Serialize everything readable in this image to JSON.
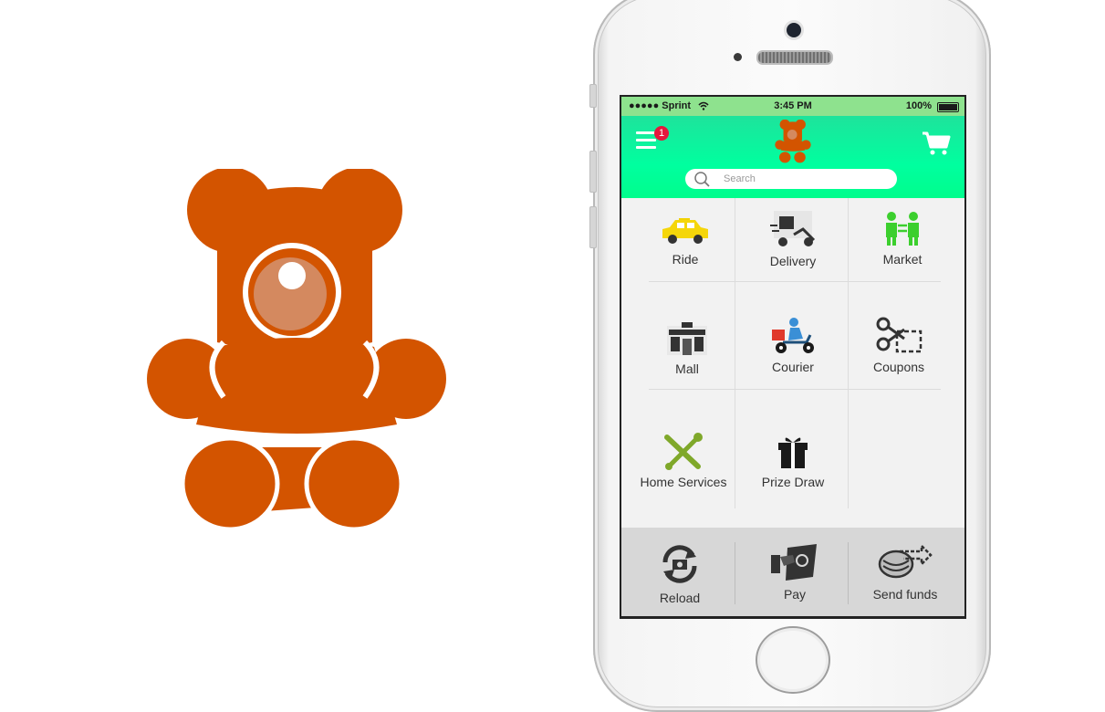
{
  "status_bar": {
    "carrier": "●●●●● Sprint",
    "time": "3:45 PM",
    "battery": "100%"
  },
  "header": {
    "menu_badge": "1",
    "search_placeholder": "Search"
  },
  "services": [
    {
      "label": "Ride",
      "icon": "taxi-icon"
    },
    {
      "label": "Delivery",
      "icon": "delivery-scooter-icon"
    },
    {
      "label": "Market",
      "icon": "market-people-icon"
    },
    {
      "label": "Mall",
      "icon": "mall-building-icon"
    },
    {
      "label": "Courier",
      "icon": "courier-scooter-icon"
    },
    {
      "label": "Coupons",
      "icon": "scissors-coupon-icon"
    },
    {
      "label": "Home Services",
      "icon": "tools-icon"
    },
    {
      "label": "Prize Draw",
      "icon": "gift-icon"
    }
  ],
  "bottom_bar": [
    {
      "label": "Reload",
      "icon": "reload-icon"
    },
    {
      "label": "Pay",
      "icon": "pay-hand-icon"
    },
    {
      "label": "Send funds",
      "icon": "send-coins-icon"
    }
  ],
  "colors": {
    "bear": "#d35400",
    "bear_face": "#d4895f",
    "header_green": "#00ff9f",
    "status_green": "#8ee28e",
    "badge_red": "#e5163d"
  }
}
